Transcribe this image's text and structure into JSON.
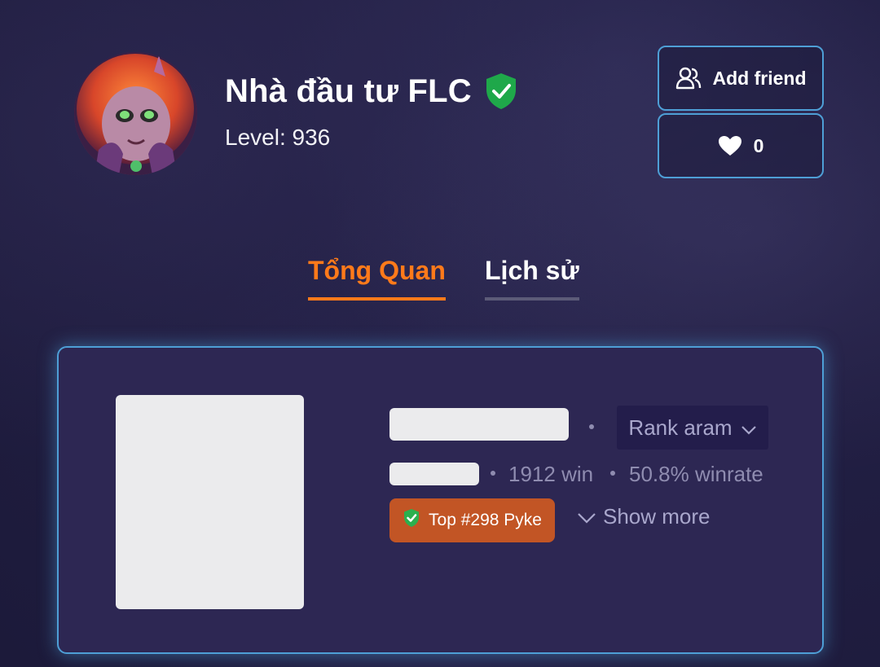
{
  "profile": {
    "name": "Nhà đầu tư FLC",
    "level_text": "Level: 936"
  },
  "actions": {
    "add_friend_label": "Add friend",
    "like_count": "0"
  },
  "tabs": [
    {
      "label": "Tổng Quan",
      "active": true
    },
    {
      "label": "Lịch sử",
      "active": false
    }
  ],
  "rank_card": {
    "queue_select": "Rank aram",
    "wins": "1912 win",
    "winrate": "50.8% winrate",
    "top_badge": "Top #298 Pyke",
    "show_more": "Show more"
  },
  "colors": {
    "accent_orange": "#ff7a1a",
    "border_blue": "#4e9fd6",
    "badge_orange": "#c25525",
    "verified_green": "#1fa84a"
  },
  "icons": {
    "verified": "shield-check-icon",
    "add_friend": "users-icon",
    "like": "heart-icon",
    "dropdown": "chevron-down-icon"
  }
}
